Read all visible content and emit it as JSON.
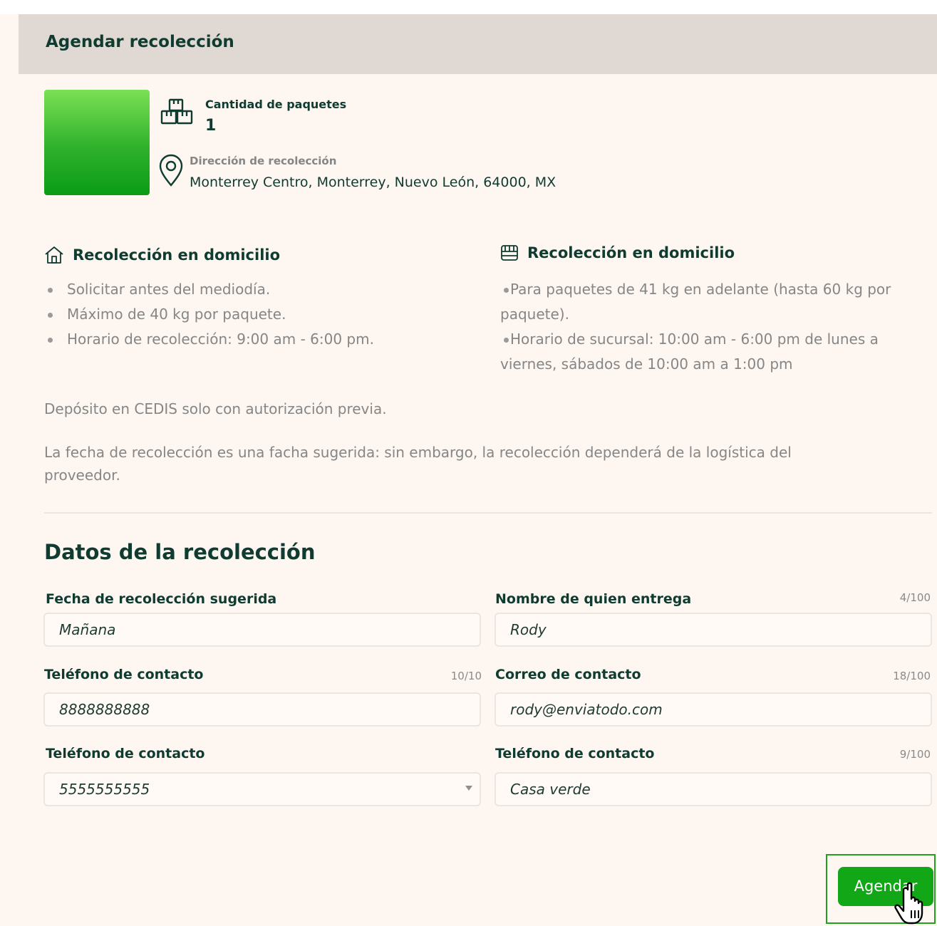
{
  "header": {
    "title": "Agendar recolección"
  },
  "summary": {
    "packages_label": "Cantidad de paquetes",
    "packages_value": "1",
    "address_label": "Dirección de recolección",
    "address_value": "Monterrey Centro, Monterrey, Nuevo León, 64000, MX"
  },
  "info": {
    "left": {
      "title": "Recolección en domicilio",
      "icon": "home-icon",
      "items": [
        "Solicitar antes del mediodía.",
        "Máximo de 40 kg por paquete.",
        "Horario de recolección: 9:00 am - 6:00 pm."
      ]
    },
    "right": {
      "title": "Recolección en domicilio",
      "icon": "store-icon",
      "items": [
        "Para paquetes de 41 kg en adelante (hasta 60 kg por paquete).",
        "Horario de sucursal: 10:00 am - 6:00 pm de lunes a viernes, sábados de 10:00 am a 1:00 pm"
      ]
    },
    "note1": "Depósito en CEDIS solo con autorización previa.",
    "note2": "La fecha de recolección es una facha sugerida: sin embargo, la recolección dependerá de la logística del proveedor."
  },
  "form": {
    "title": "Datos de la recolección",
    "date": {
      "label": "Fecha de recolección sugerida",
      "value": "Mañana"
    },
    "name": {
      "label": "Nombre de quien entrega",
      "value": "Rody",
      "counter": "4/100"
    },
    "phone": {
      "label": "Teléfono de contacto",
      "value": "8888888888",
      "counter": "10/10"
    },
    "email": {
      "label": "Correo de contacto",
      "value": "rody@enviatodo.com",
      "counter": "18/100"
    },
    "phone2": {
      "label": "Teléfono de contacto",
      "value": "5555555555"
    },
    "ref": {
      "label": "Teléfono de contacto",
      "value": "Casa verde",
      "counter": "9/100"
    }
  },
  "actions": {
    "submit_label": "Agendar"
  },
  "colors": {
    "accent": "#11a716",
    "header_bg": "#e0d8d3",
    "page_bg": "#fdf6f1",
    "heading": "#0f3b30"
  }
}
